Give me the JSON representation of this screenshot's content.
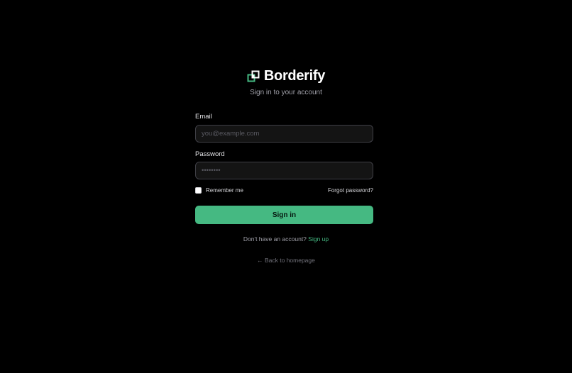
{
  "brand": {
    "name": "Borderify",
    "logo_icon": "overlapping-squares-icon",
    "accent_color": "#45b982"
  },
  "subtitle": "Sign in to your account",
  "form": {
    "email": {
      "label": "Email",
      "value": "",
      "placeholder": "you@example.com"
    },
    "password": {
      "label": "Password",
      "value": "",
      "placeholder": "••••••••"
    },
    "remember_me": {
      "label": "Remember me",
      "checked": false
    },
    "forgot_password": "Forgot password?",
    "submit_label": "Sign in"
  },
  "signup": {
    "prompt": "Don't have an account?",
    "link": "Sign up"
  },
  "back_link": "← Back to homepage",
  "colors": {
    "background": "#000000",
    "input_background": "#141414",
    "input_border": "#3f3f46",
    "button": "#45b982"
  }
}
